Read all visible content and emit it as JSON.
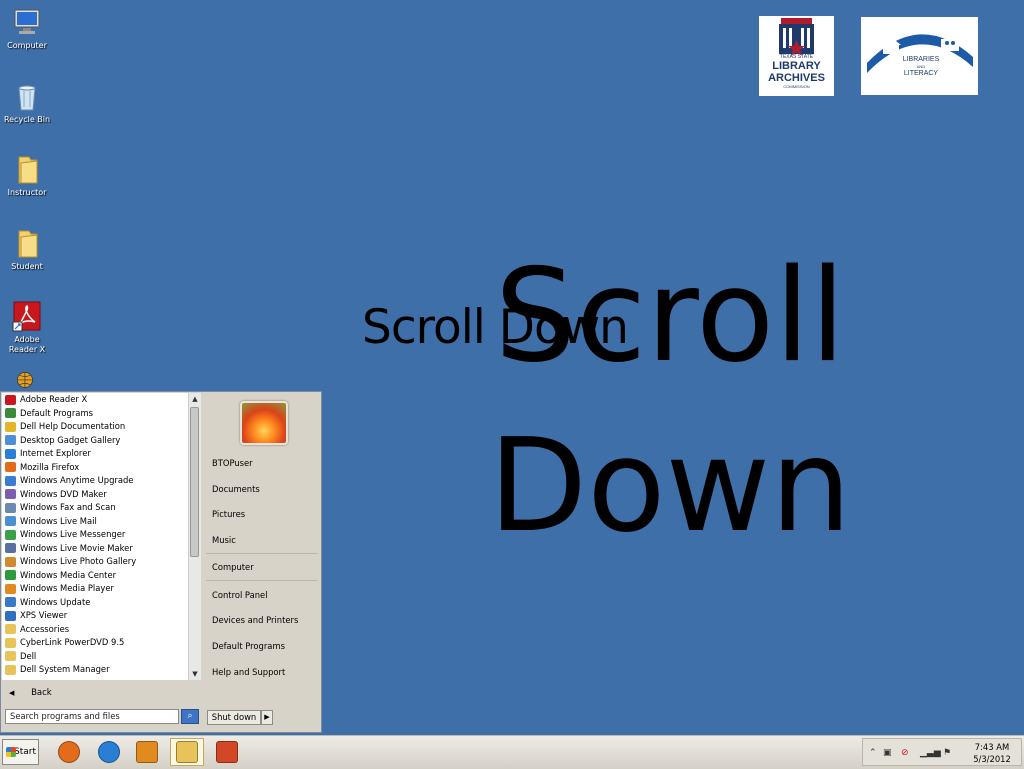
{
  "desktop": {
    "icons": [
      {
        "label": "Computer",
        "icon": "computer-icon"
      },
      {
        "label": "Recycle Bin",
        "icon": "recycle-bin-icon"
      },
      {
        "label": "Instructor",
        "icon": "folder-icon"
      },
      {
        "label": "Student",
        "icon": "folder-icon"
      },
      {
        "label": "Adobe Reader X",
        "icon": "adobe-reader-icon"
      }
    ],
    "overlay_small": "Scroll Down",
    "overlay_big": "Scroll Down",
    "logos": [
      {
        "name": "TEXAS STATE LIBRARY ARCHIVES COMMISSION",
        "lines": [
          "TEXAS STATE",
          "LIBRARY",
          "ARCHIVES",
          "COMMISSION"
        ]
      },
      {
        "name": "LIBRARIES AND LITERACY",
        "lines": [
          "LIBRARIES",
          "AND",
          "LITERACY"
        ]
      }
    ]
  },
  "start_menu": {
    "programs": [
      {
        "label": "Adobe Reader X",
        "color": "#c8171e"
      },
      {
        "label": "Default Programs",
        "color": "#3a8a3a"
      },
      {
        "label": "Dell Help Documentation",
        "color": "#e0b62a"
      },
      {
        "label": "Desktop Gadget Gallery",
        "color": "#4b8fd6"
      },
      {
        "label": "Internet Explorer",
        "color": "#2a7ed6"
      },
      {
        "label": "Mozilla Firefox",
        "color": "#e36b1c"
      },
      {
        "label": "Windows Anytime Upgrade",
        "color": "#3b7bd0"
      },
      {
        "label": "Windows DVD Maker",
        "color": "#7a5fb0"
      },
      {
        "label": "Windows Fax and Scan",
        "color": "#6a8ab0"
      },
      {
        "label": "Windows Live Mail",
        "color": "#4a90d0"
      },
      {
        "label": "Windows Live Messenger",
        "color": "#3aa04a"
      },
      {
        "label": "Windows Live Movie Maker",
        "color": "#5a6fa0"
      },
      {
        "label": "Windows Live Photo Gallery",
        "color": "#d08a30"
      },
      {
        "label": "Windows Media Center",
        "color": "#2f9a3a"
      },
      {
        "label": "Windows Media Player",
        "color": "#e08a20"
      },
      {
        "label": "Windows Update",
        "color": "#3a78c8"
      },
      {
        "label": "XPS Viewer",
        "color": "#2f6fbf"
      },
      {
        "label": "Accessories",
        "color": "#e8c35a"
      },
      {
        "label": "CyberLink PowerDVD 9.5",
        "color": "#e8c35a"
      },
      {
        "label": "Dell",
        "color": "#e8c35a"
      },
      {
        "label": "Dell System Manager",
        "color": "#e8c35a"
      }
    ],
    "back_label": "Back",
    "search_placeholder": "Search programs and files",
    "right_items": {
      "user": "BTOPuser",
      "documents": "Documents",
      "pictures": "Pictures",
      "music": "Music",
      "computer": "Computer",
      "control_panel": "Control Panel",
      "devices": "Devices and Printers",
      "default_programs": "Default Programs",
      "help": "Help and Support"
    },
    "shutdown_label": "Shut down"
  },
  "taskbar": {
    "start_label": "Start",
    "pinned": [
      {
        "name": "firefox",
        "icon": "firefox-icon",
        "color": "#e36b1c"
      },
      {
        "name": "internet-explorer",
        "icon": "ie-icon",
        "color": "#2a7ed6"
      },
      {
        "name": "media-player",
        "icon": "media-player-icon",
        "color": "#e08a20"
      },
      {
        "name": "file-explorer",
        "icon": "folder-icon",
        "color": "#e8c35a"
      },
      {
        "name": "powerpoint",
        "icon": "powerpoint-icon",
        "color": "#d24726"
      }
    ],
    "clock_time": "7:43 AM",
    "clock_date": "5/3/2012"
  }
}
